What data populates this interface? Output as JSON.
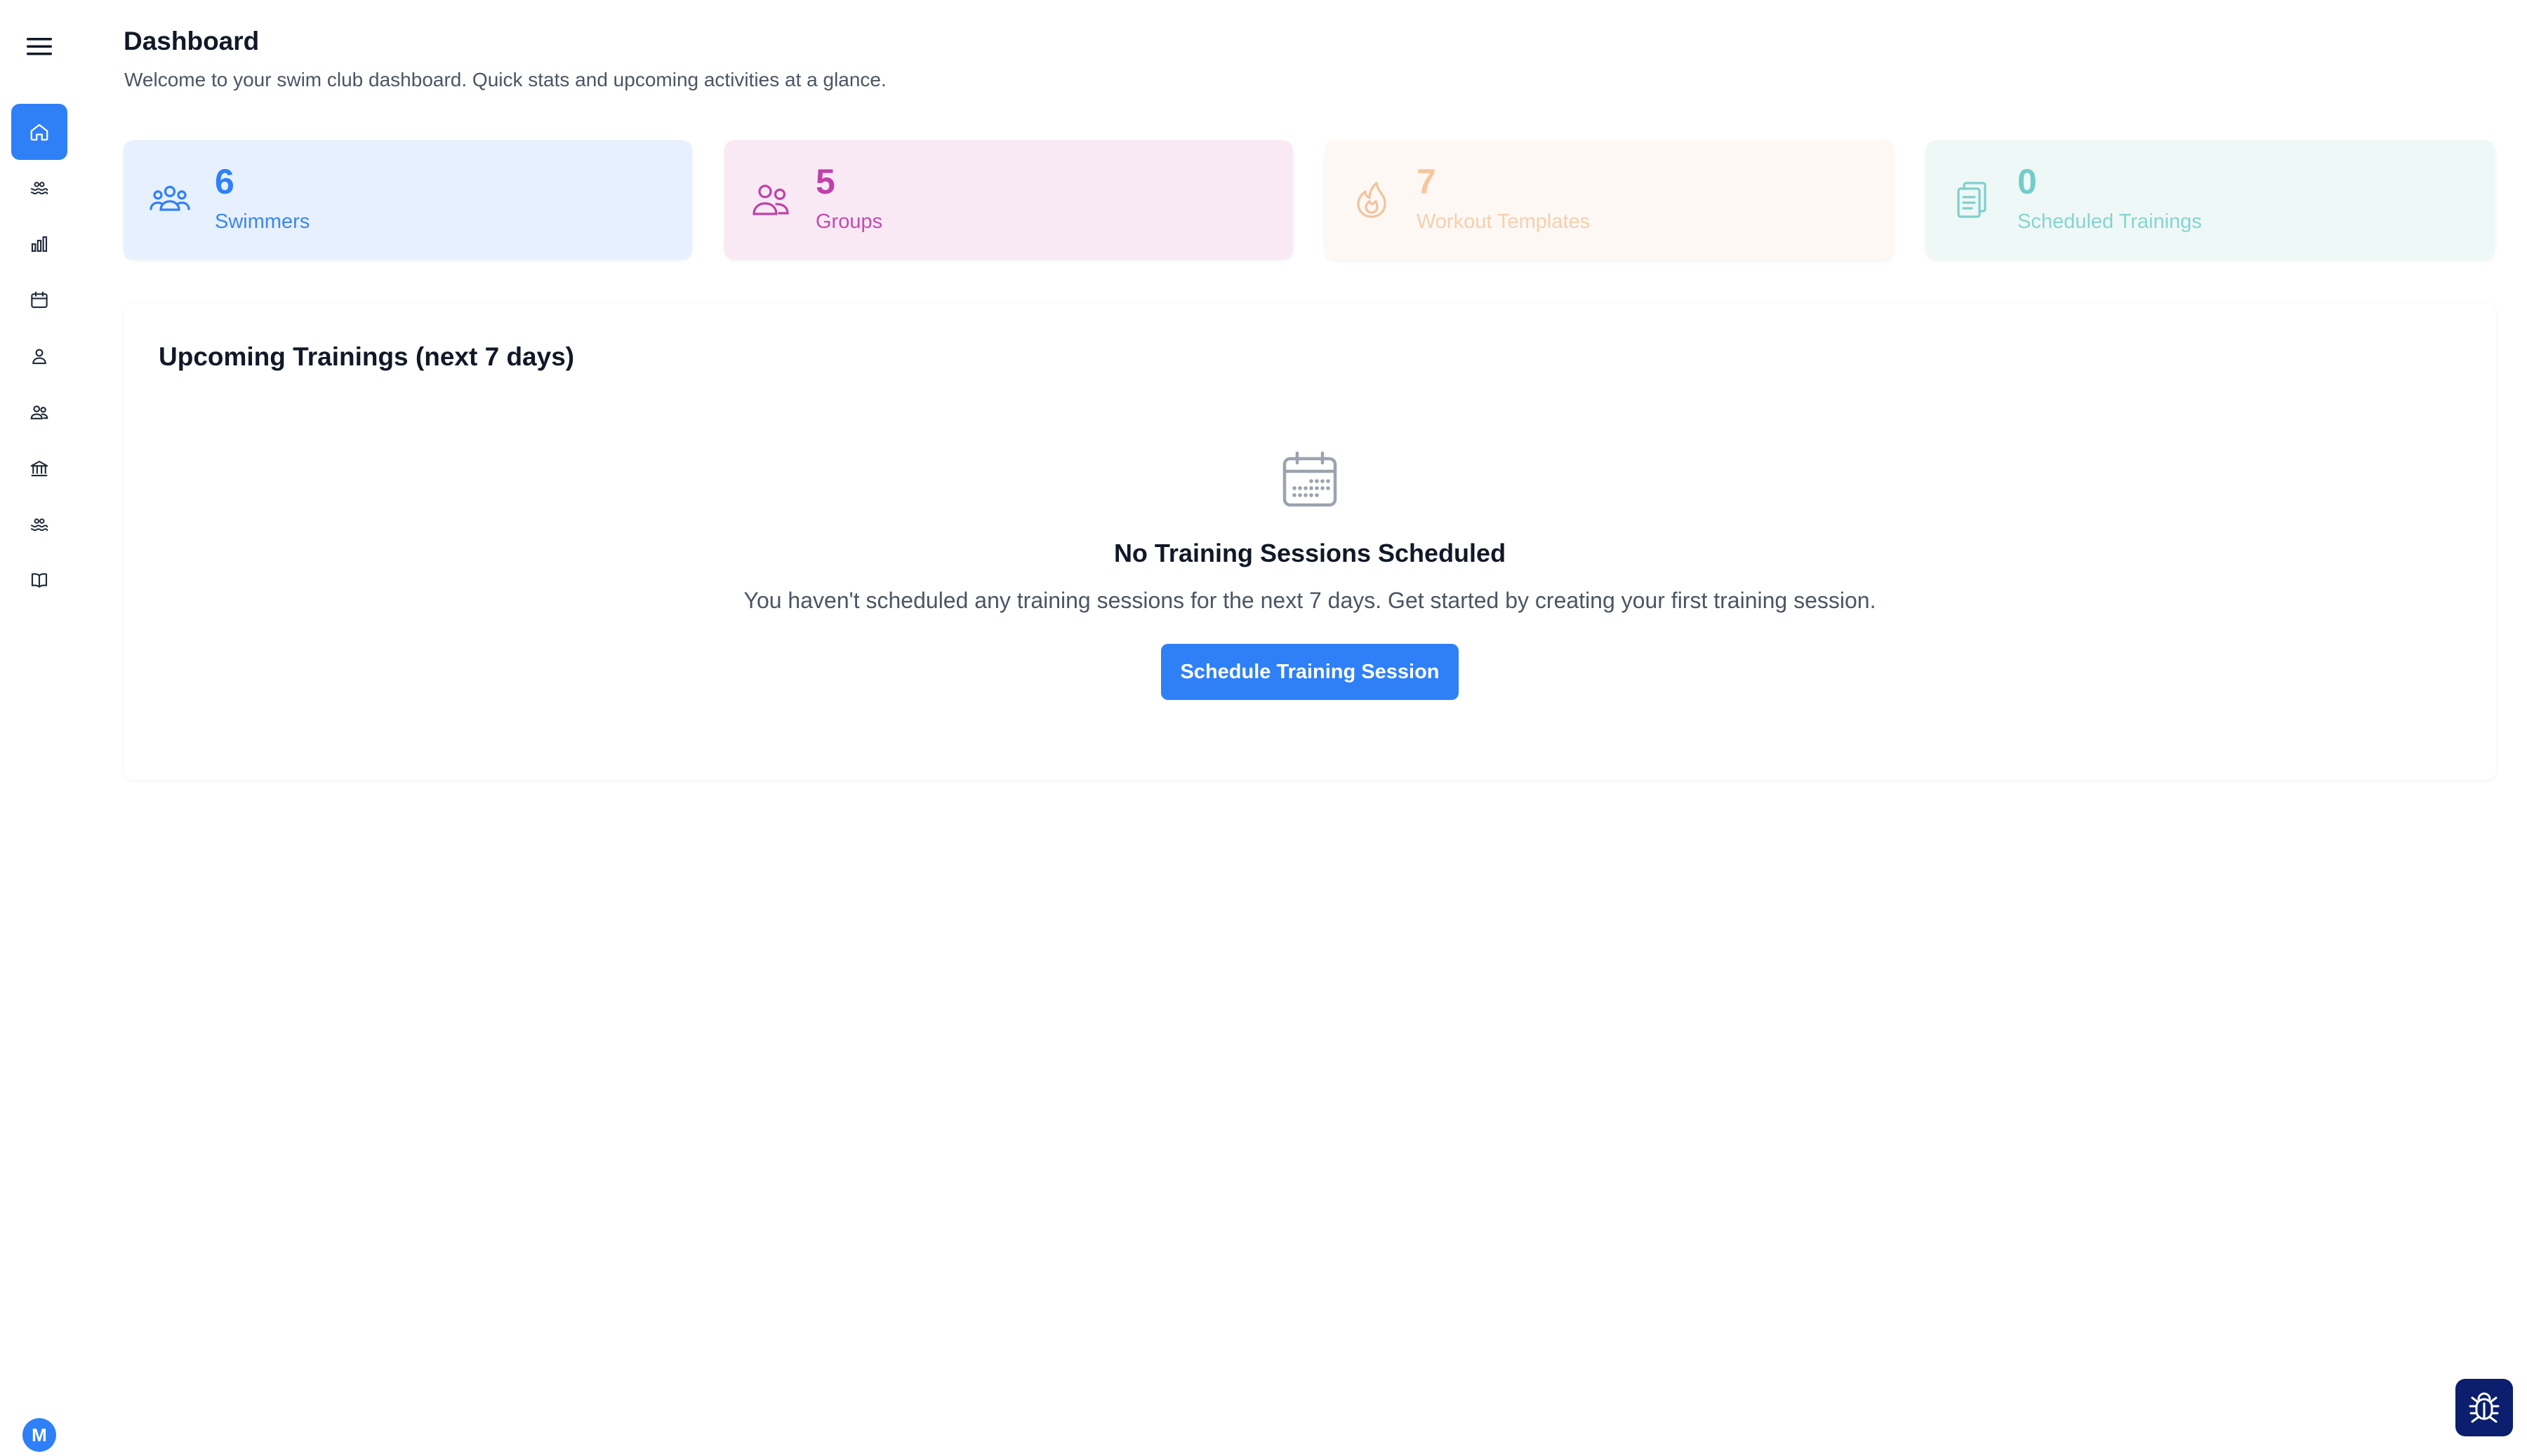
{
  "header": {
    "title": "Dashboard",
    "subtitle": "Welcome to your swim club dashboard. Quick stats and upcoming activities at a glance."
  },
  "sidebar": {
    "items": [
      {
        "icon": "home-icon",
        "active": true
      },
      {
        "icon": "swimmer-icon",
        "active": false
      },
      {
        "icon": "bar-chart-icon",
        "active": false
      },
      {
        "icon": "calendar-icon",
        "active": false
      },
      {
        "icon": "user-icon",
        "active": false
      },
      {
        "icon": "users-icon",
        "active": false
      },
      {
        "icon": "building-icon",
        "active": false
      },
      {
        "icon": "swimmer-icon",
        "active": false
      },
      {
        "icon": "book-icon",
        "active": false
      }
    ],
    "avatar_initial": "M"
  },
  "stats": [
    {
      "value": "6",
      "label": "Swimmers",
      "icon": "users-group-icon",
      "color": "#2f80f7"
    },
    {
      "value": "5",
      "label": "Groups",
      "icon": "users-icon",
      "color": "#c040a8"
    },
    {
      "value": "7",
      "label": "Workout Templates",
      "icon": "flame-icon",
      "color": "#f7c9a0"
    },
    {
      "value": "0",
      "label": "Scheduled Trainings",
      "icon": "clipboard-icon",
      "color": "#7fd0cc"
    }
  ],
  "upcoming": {
    "title": "Upcoming Trainings (next 7 days)",
    "empty_title": "No Training Sessions Scheduled",
    "empty_description": "You haven't scheduled any training sessions for the next 7 days. Get started by creating your first training session.",
    "button_label": "Schedule Training Session"
  },
  "colors": {
    "accent": "#2f80f7",
    "bug_button": "#0b1f6e"
  }
}
